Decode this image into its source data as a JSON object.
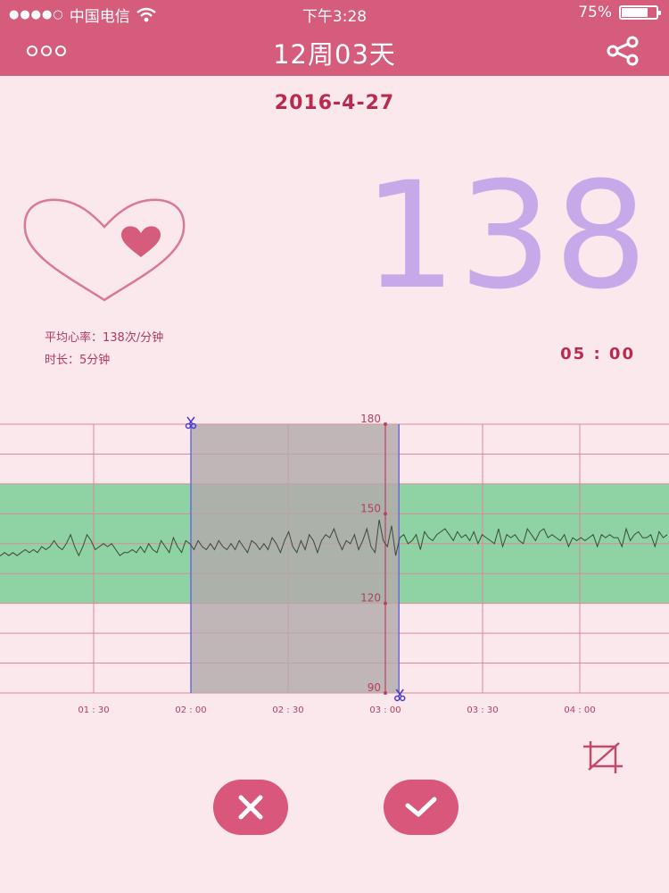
{
  "status_bar": {
    "carrier": "中国电信",
    "time": "下午3:28",
    "battery_percent": "75%",
    "battery_level": 0.75
  },
  "nav": {
    "title": "12周03天"
  },
  "date": "2016-4-27",
  "heart_rate": {
    "value": "138",
    "average_label": "平均心率：138次/分钟",
    "duration_label": "时长：5分钟",
    "timer": "05 : 00"
  },
  "chart_data": {
    "type": "line",
    "x_ticks": [
      "01 : 30",
      "02 : 00",
      "02 : 30",
      "03 : 00",
      "03 : 30",
      "04 : 00"
    ],
    "y_ticks": [
      "180",
      "150",
      "120",
      "90"
    ],
    "ylim": [
      90,
      180
    ],
    "normal_range": [
      120,
      160
    ],
    "selection_minutes": [
      2.0,
      3.07
    ],
    "series": [
      {
        "values": [
          136,
          136,
          137,
          136,
          137,
          136,
          137,
          138,
          137,
          138,
          137,
          139,
          138,
          139,
          141,
          139,
          138,
          140,
          143,
          139,
          136,
          139,
          143,
          141,
          138,
          139,
          140,
          139,
          140,
          138,
          136,
          137,
          137,
          138,
          137,
          139,
          137,
          140,
          138,
          137,
          141,
          139,
          137,
          142,
          139,
          137,
          141,
          140,
          138,
          141,
          139,
          138,
          140,
          138,
          141,
          139,
          138,
          140,
          138,
          141,
          139,
          137,
          141,
          140,
          138,
          140,
          138,
          142,
          140,
          137,
          141,
          144,
          139,
          137,
          141,
          138,
          143,
          141,
          137,
          141,
          143,
          142,
          145,
          141,
          138,
          141,
          140,
          143,
          138,
          141,
          145,
          139,
          137,
          148,
          141,
          139,
          146,
          136,
          142,
          143,
          140,
          141,
          143,
          138,
          144,
          142,
          141,
          143,
          144,
          145,
          143,
          141,
          144,
          142,
          143,
          141,
          144,
          140,
          143,
          142,
          141,
          140,
          145,
          139,
          143,
          142,
          143,
          141,
          140,
          145,
          143,
          141,
          144,
          145,
          142,
          143,
          142,
          141,
          143,
          139,
          142,
          141,
          142,
          141,
          142,
          143,
          139,
          143,
          142,
          143,
          142,
          142,
          139,
          145,
          141,
          143,
          144,
          142,
          142,
          143,
          139,
          144,
          142,
          143
        ],
        "x_start_minutes": 1.0,
        "x_end_minutes": 4.45
      }
    ]
  },
  "buttons": {
    "cancel_icon": "close-icon",
    "confirm_icon": "check-icon",
    "crop_icon": "crop-icon"
  },
  "colors": {
    "brand": "#d65c7c",
    "background": "#fbe8ec",
    "bpm": "#c7a9ea",
    "normal_band": "#8fd3a4",
    "selection": "#b3a9aa"
  }
}
